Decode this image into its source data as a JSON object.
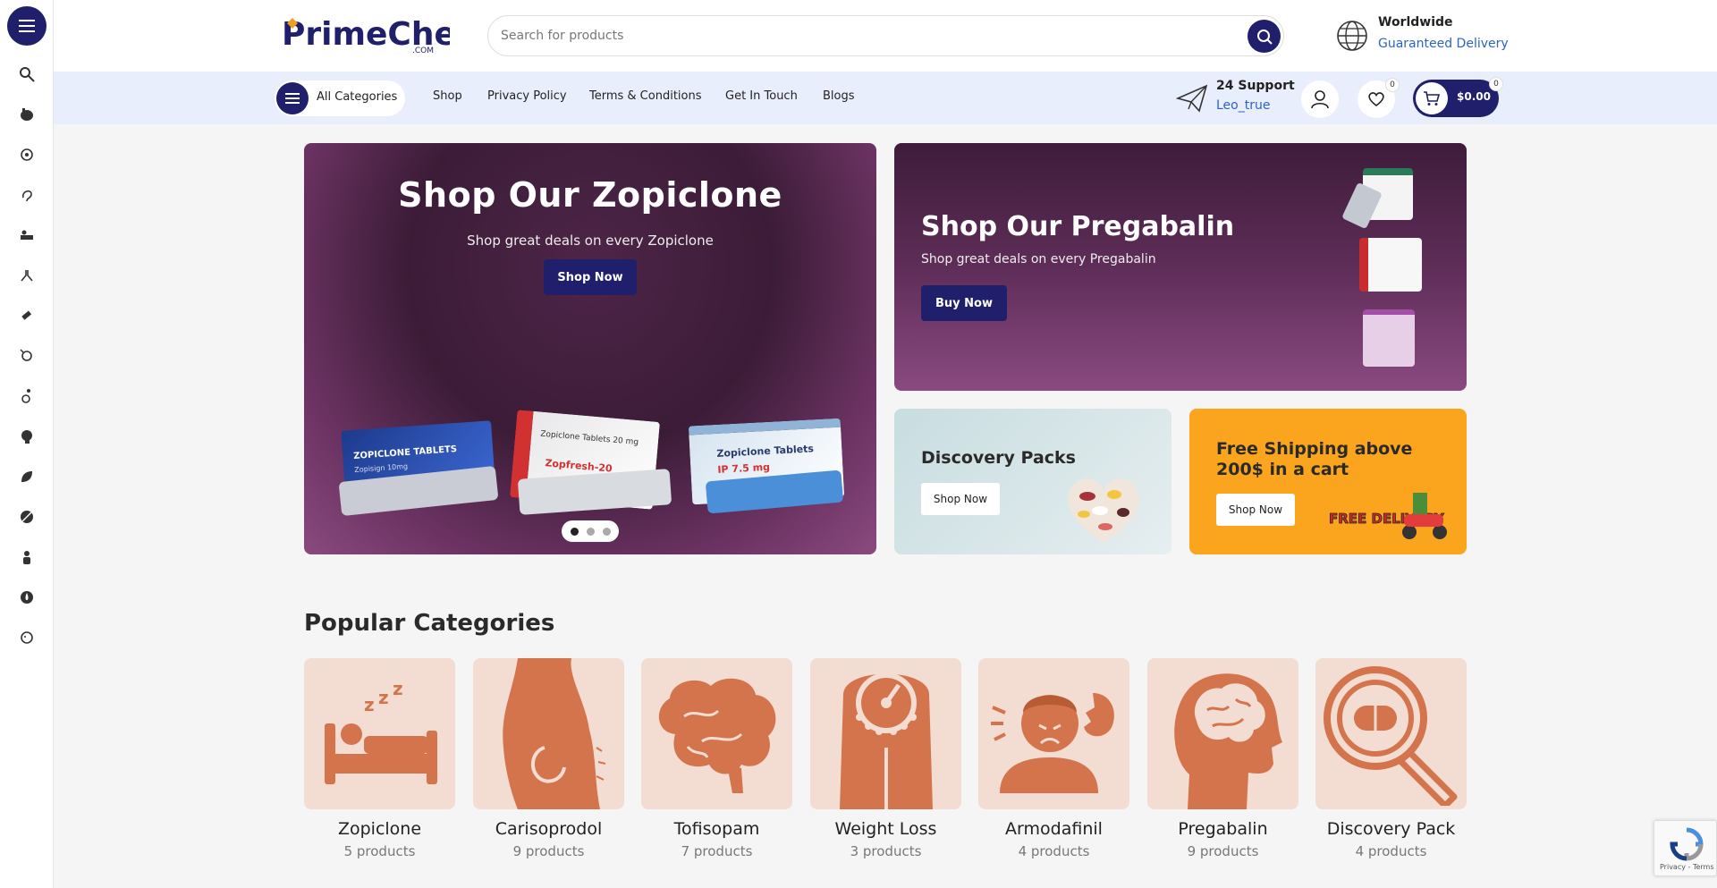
{
  "search": {
    "placeholder": "Search for products"
  },
  "delivery": {
    "title": "Worldwide",
    "subtitle": "Guaranteed Delivery"
  },
  "logo": {
    "text": "PrimeChems",
    "suffix": ".COM"
  },
  "nav": {
    "all_categories": "All Categories",
    "links": [
      "Shop",
      "Privacy Policy",
      "Terms & Conditions",
      "Get In Touch",
      "Blogs"
    ]
  },
  "support": {
    "title": "24 Support",
    "subtitle": "Leo_true"
  },
  "wishlist": {
    "count": "0"
  },
  "cart": {
    "count": "0",
    "total": "$0.00"
  },
  "hero": {
    "title": "Shop Our Zopiclone",
    "subtitle": "Shop great deals on every Zopiclone",
    "button": "Shop Now",
    "packs": [
      "ZOPICLONE TABLETS",
      "Zopiclone Tablets 20 mg",
      "Zopiclone Tablets"
    ],
    "pack_subs": [
      "Zopisign 10mg",
      "Zopfresh-20",
      "IP 7.5 mg"
    ]
  },
  "side_banner": {
    "title": "Shop Our Pregabalin",
    "subtitle": "Shop great deals on every Pregabalin",
    "button": "Buy Now"
  },
  "promo_discovery": {
    "title": "Discovery Packs",
    "button": "Shop Now"
  },
  "promo_shipping": {
    "title": "Free Shipping above 200$ in a cart",
    "button": "Shop Now",
    "art_text": "FREE DELIVERY"
  },
  "categories": {
    "title": "Popular Categories",
    "items": [
      {
        "name": "Zopiclone",
        "count": "5 products",
        "icon": "sleep-bed-icon"
      },
      {
        "name": "Carisoprodol",
        "count": "9 products",
        "icon": "back-pain-icon"
      },
      {
        "name": "Tofisopam",
        "count": "7 products",
        "icon": "brain-icon"
      },
      {
        "name": "Weight Loss",
        "count": "3 products",
        "icon": "scale-icon"
      },
      {
        "name": "Armodafinil",
        "count": "4 products",
        "icon": "headache-icon"
      },
      {
        "name": "Pregabalin",
        "count": "9 products",
        "icon": "head-brain-icon"
      },
      {
        "name": "Discovery Pack",
        "count": "4 products",
        "icon": "magnifier-pill-icon"
      }
    ]
  },
  "recaptcha": {
    "links": "Privacy - Terms"
  },
  "colors": {
    "navy": "#1f1f6b",
    "nav_bg": "#e8eefb",
    "category_bg": "#f3ddd3",
    "category_icon": "#d4744c",
    "promo_orange": "#fba51e"
  }
}
